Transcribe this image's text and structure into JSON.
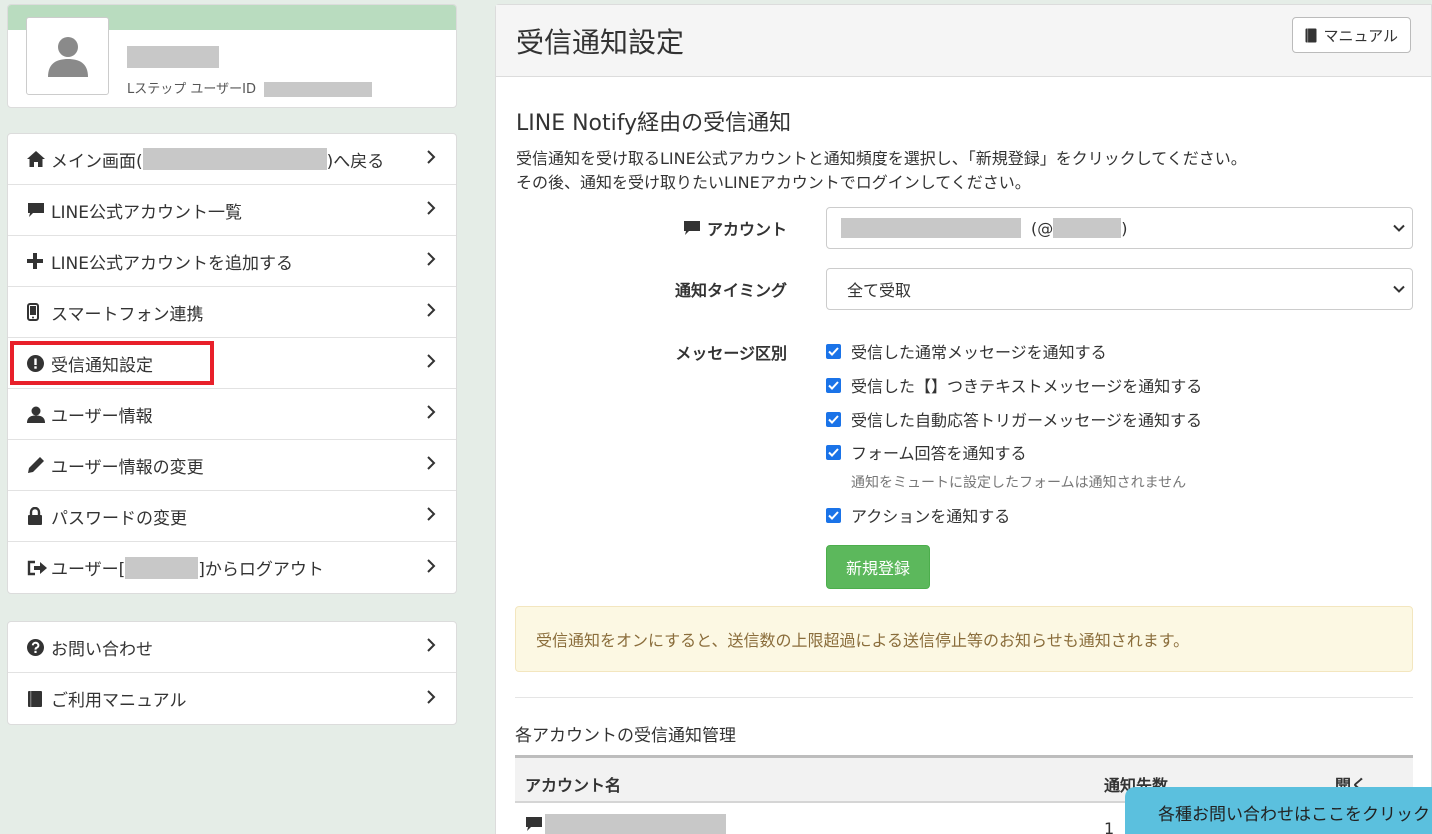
{
  "profile": {
    "id_label": "Lステップ ユーザーID"
  },
  "menu_main": [
    {
      "label_prefix": "メイン画面(",
      "label_suffix": ")へ戻る",
      "icon": "home-icon"
    },
    {
      "label": "LINE公式アカウント一覧",
      "icon": "comment-icon"
    },
    {
      "label": "LINE公式アカウントを追加する",
      "icon": "plus-icon"
    },
    {
      "label": "スマートフォン連携",
      "icon": "mobile-icon"
    },
    {
      "label": "受信通知設定",
      "icon": "exclamation-circle-icon"
    },
    {
      "label": "ユーザー情報",
      "icon": "user-icon"
    },
    {
      "label": "ユーザー情報の変更",
      "icon": "pencil-icon"
    },
    {
      "label": "パスワードの変更",
      "icon": "lock-icon"
    },
    {
      "label_prefix": "ユーザー[",
      "label_suffix": "]からログアウト",
      "icon": "logout-icon"
    }
  ],
  "menu_support": [
    {
      "label": "お問い合わせ",
      "icon": "question-circle-icon"
    },
    {
      "label": "ご利用マニュアル",
      "icon": "book-icon"
    }
  ],
  "panel": {
    "title": "受信通知設定",
    "manual_button": "マニュアル",
    "section_title": "LINE Notify経由の受信通知",
    "desc_line1": "受信通知を受け取るLINE公式アカウントと通知頻度を選択し、「新規登録」をクリックしてください。",
    "desc_line2": "その後、通知を受け取りたいLINEアカウントでログインしてください。"
  },
  "form": {
    "account_label": "アカウント",
    "account_handle_prefix": "(@",
    "account_handle_suffix": ")",
    "timing_label": "通知タイミング",
    "timing_value": "全て受取",
    "message_label": "メッセージ区別",
    "checks": [
      {
        "label": "受信した通常メッセージを通知する",
        "checked": true
      },
      {
        "label": "受信した【】つきテキストメッセージを通知する",
        "checked": true
      },
      {
        "label": "受信した自動応答トリガーメッセージを通知する",
        "checked": true
      },
      {
        "label": "フォーム回答を通知する",
        "checked": true
      },
      {
        "label": "アクションを通知する",
        "checked": true
      }
    ],
    "form_hint": "通知をミュートに設定したフォームは通知されません",
    "register_button": "新規登録"
  },
  "alert": {
    "text": "受信通知をオンにすると、送信数の上限超過による送信停止等のお知らせも通知されます。"
  },
  "management": {
    "title": "各アカウントの受信通知管理",
    "columns": [
      "アカウント名",
      "通知先数",
      "開く"
    ],
    "rows": [
      {
        "count": "1"
      }
    ]
  },
  "contact_float": {
    "text": "各種お問い合わせはここをクリック"
  },
  "colors": {
    "accent_green": "#5cb85c",
    "checkbox_blue": "#1a73e8",
    "highlight_red": "#e8202a",
    "alert_bg": "#fcf8e3",
    "float_bg": "#5bc0de"
  }
}
